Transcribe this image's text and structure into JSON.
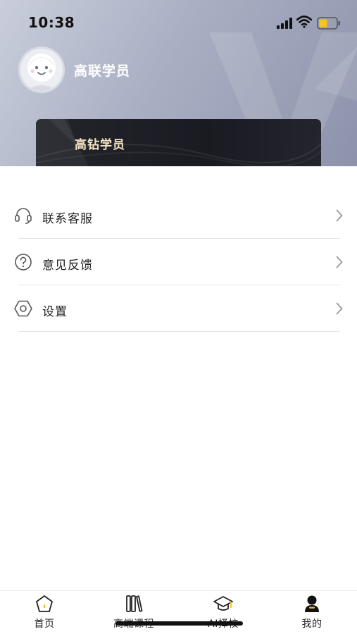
{
  "status_bar": {
    "time": "10:38",
    "icons": [
      "signal-icon",
      "wifi-icon",
      "battery-icon"
    ],
    "battery_color": "#f5c518"
  },
  "profile": {
    "name": "高联学员",
    "member_level": "高钻学员"
  },
  "menu": [
    {
      "label": "联系客服",
      "icon": "headset-icon"
    },
    {
      "label": "意见反馈",
      "icon": "question-circle-icon"
    },
    {
      "label": "设置",
      "icon": "hexagon-settings-icon"
    }
  ],
  "tabbar": [
    {
      "label": "首页",
      "icon": "home-icon"
    },
    {
      "label": "高端课程",
      "icon": "books-icon"
    },
    {
      "label": "AI择校",
      "icon": "graduation-cap-icon"
    },
    {
      "label": "我的",
      "icon": "profile-icon",
      "active": true
    }
  ],
  "colors": {
    "accent": "#f5c518",
    "card_bg": "#1f2027",
    "card_text": "#f3e3c3"
  }
}
